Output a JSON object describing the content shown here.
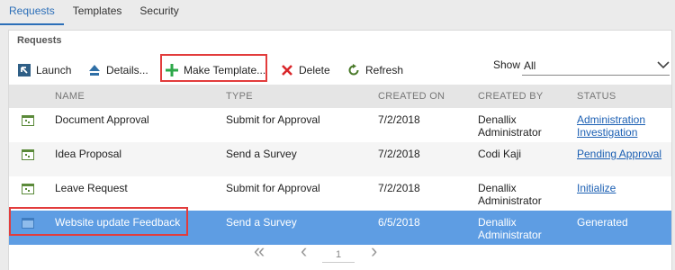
{
  "tabs": [
    {
      "label": "Requests"
    },
    {
      "label": "Templates"
    },
    {
      "label": "Security"
    }
  ],
  "panel": {
    "title": "Requests"
  },
  "toolbar": {
    "launch": "Launch",
    "details": "Details...",
    "make_template": "Make Template...",
    "delete": "Delete",
    "refresh": "Refresh"
  },
  "filter": {
    "label": "Show",
    "value": "All"
  },
  "columns": {
    "name": "NAME",
    "type": "TYPE",
    "created_on": "CREATED ON",
    "created_by": "CREATED BY",
    "status": "STATUS"
  },
  "rows": [
    {
      "name": "Document Approval",
      "type": "Submit for Approval",
      "created_on": "7/2/2018",
      "created_by_1": "Denallix",
      "created_by_2": "Administrator",
      "status_1": "Administration",
      "status_2": "Investigation"
    },
    {
      "name": "Idea Proposal",
      "type": "Send a Survey",
      "created_on": "7/2/2018",
      "created_by_1": "Codi Kaji",
      "created_by_2": "",
      "status_1": "Pending Approval",
      "status_2": ""
    },
    {
      "name": "Leave Request",
      "type": "Submit for Approval",
      "created_on": "7/2/2018",
      "created_by_1": "Denallix",
      "created_by_2": "Administrator",
      "status_1": "Initialize",
      "status_2": ""
    },
    {
      "name": "Website update Feedback",
      "type": "Send a Survey",
      "created_on": "6/5/2018",
      "created_by_1": "Denallix",
      "created_by_2": "Administrator",
      "status_1": "Generated",
      "status_2": ""
    }
  ],
  "pager": {
    "first": "«",
    "prev": "‹",
    "page": "1",
    "next": "›"
  },
  "colors": {
    "accent": "#2c6fb8",
    "selected_row": "#5e9de3",
    "highlight": "#e23c3c",
    "add_green": "#2ea84a",
    "delete_red": "#d9262a"
  }
}
